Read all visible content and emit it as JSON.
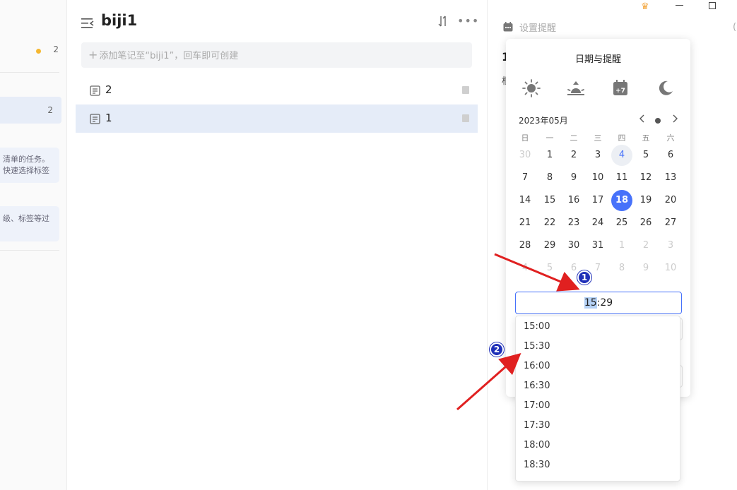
{
  "sidebar": {
    "row1_count": "2",
    "selected_count": "2",
    "card1_line1": "清单的任务。",
    "card1_line2": "快速选择标签",
    "card2_line1": "级、标签等过"
  },
  "list": {
    "title": "biji1",
    "add_placeholder": "添加笔记至“biji1”，回车即可创建",
    "notes": [
      {
        "title": "2"
      },
      {
        "title": "1"
      }
    ]
  },
  "detail": {
    "reminder_label": "设置提醒",
    "title_frag": "1",
    "body_frag": "根",
    "edge_frag": "("
  },
  "popup": {
    "title": "日期与提醒",
    "quick_icons": [
      "sun-icon",
      "sunrise-icon",
      "calendar-plus7-icon",
      "moon-icon"
    ],
    "month_label": "2023年05月",
    "weekdays": [
      "日",
      "一",
      "二",
      "三",
      "四",
      "五",
      "六"
    ],
    "weeks": [
      [
        "30",
        "1",
        "2",
        "3",
        "4",
        "5",
        "6"
      ],
      [
        "7",
        "8",
        "9",
        "10",
        "11",
        "12",
        "13"
      ],
      [
        "14",
        "15",
        "16",
        "17",
        "18",
        "19",
        "20"
      ],
      [
        "21",
        "22",
        "23",
        "24",
        "25",
        "26",
        "27"
      ],
      [
        "28",
        "29",
        "30",
        "31",
        "1",
        "2",
        "3"
      ],
      [
        "4",
        "5",
        "6",
        "7",
        "8",
        "9",
        "10"
      ]
    ],
    "today_day": "4",
    "selected_day": "18",
    "time": {
      "hour": "15",
      "sep": ":",
      "minute": "29"
    },
    "time_options": [
      "15:00",
      "15:30",
      "16:00",
      "16:30",
      "17:00",
      "17:30",
      "18:00",
      "18:30"
    ]
  },
  "annotations": {
    "badge1": "1",
    "badge2": "2",
    "arrow_color": "#e02020"
  },
  "colors": {
    "accent": "#4772fa",
    "selection": "#e5ecf8"
  }
}
